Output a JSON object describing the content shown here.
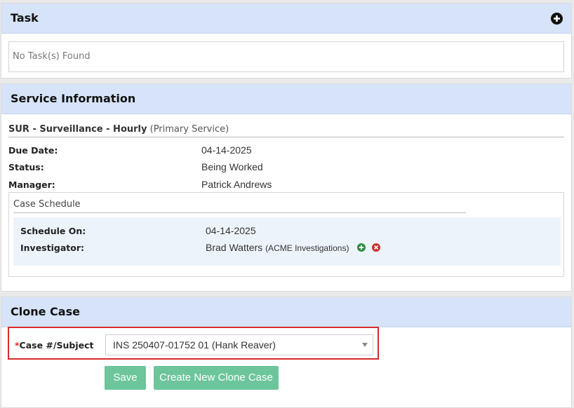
{
  "task_panel": {
    "title": "Task",
    "empty_text": "No Task(s) Found"
  },
  "service_panel": {
    "title": "Service Information",
    "service_name": "SUR - Surveillance - Hourly",
    "service_tag": "(Primary Service)",
    "fields": [
      {
        "label": "Due Date:",
        "value": "04-14-2025"
      },
      {
        "label": "Status:",
        "value": "Being Worked"
      },
      {
        "label": "Manager:",
        "value": "Patrick Andrews"
      }
    ],
    "schedule": {
      "title": "Case Schedule",
      "schedule_on_label": "Schedule On:",
      "schedule_on_value": "04-14-2025",
      "investigator_label": "Investigator:",
      "investigator_name": "Brad Watters",
      "investigator_company": "(ACME Investigations)"
    }
  },
  "clone_panel": {
    "title": "Clone Case",
    "required_mark": "*",
    "case_label": "Case #/Subject",
    "selected_case": "INS 250407-01752 01 (Hank Reaver)",
    "save_label": "Save",
    "create_label": "Create New Clone Case"
  },
  "colors": {
    "header_bg": "#d6e3f8",
    "button_green": "#6cc59b",
    "highlight_red": "#d92b2b",
    "add_icon_green": "#2e8b3e",
    "remove_icon_red": "#c9302c"
  },
  "icons": [
    "add-task-icon",
    "add-investigator-icon",
    "remove-investigator-icon",
    "dropdown-caret-icon"
  ]
}
